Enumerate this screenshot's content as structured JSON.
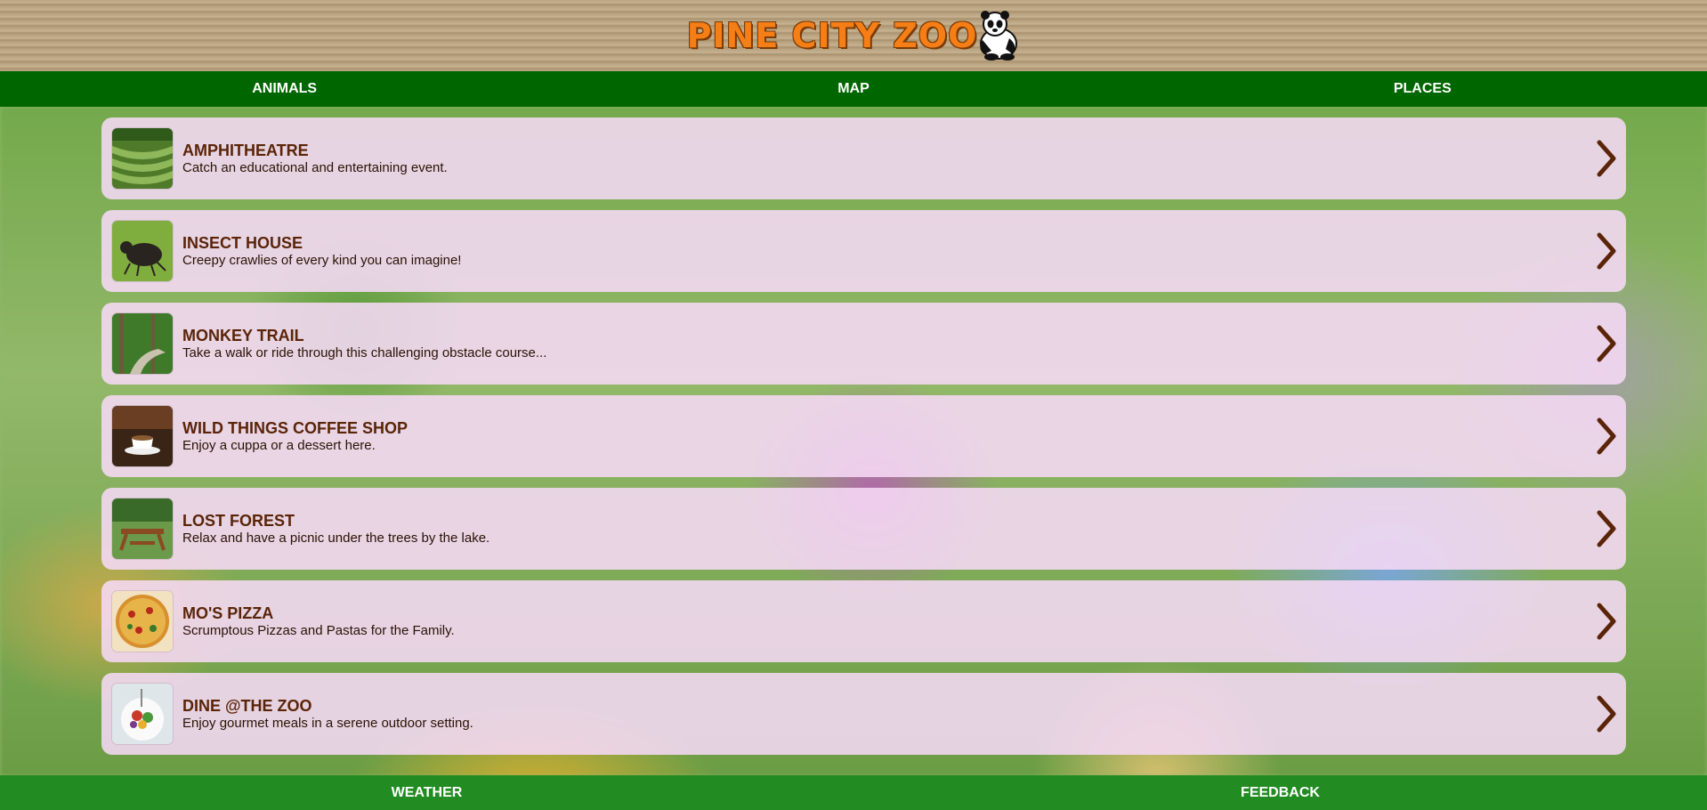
{
  "header": {
    "logo_text": "PINE CITY ZOO"
  },
  "topnav": {
    "items": [
      "ANIMALS",
      "MAP",
      "PLACES"
    ]
  },
  "places": [
    {
      "title": "AMPHITHEATRE",
      "description": "Catch an educational and entertaining event."
    },
    {
      "title": "INSECT HOUSE",
      "description": "Creepy crawlies of every kind you can imagine!"
    },
    {
      "title": "MONKEY TRAIL",
      "description": "Take a walk or ride through this challenging obstacle course..."
    },
    {
      "title": "WILD THINGS COFFEE SHOP",
      "description": "Enjoy a cuppa or a dessert here."
    },
    {
      "title": "LOST FOREST",
      "description": "Relax and have a picnic under the trees by the lake."
    },
    {
      "title": "MO'S PIZZA",
      "description": "Scrumptous Pizzas and Pastas for the Family."
    },
    {
      "title": "DINE @THE ZOO",
      "description": "Enjoy gourmet meals in a serene outdoor setting."
    }
  ],
  "bottomnav": {
    "items": [
      "WEATHER",
      "FEEDBACK"
    ]
  },
  "colors": {
    "topnav_bg": "#006600",
    "bottomnav_bg": "#228b22",
    "card_bg": "#f6daf6",
    "title_color": "#5a2408",
    "logo_orange": "#f57e16"
  }
}
